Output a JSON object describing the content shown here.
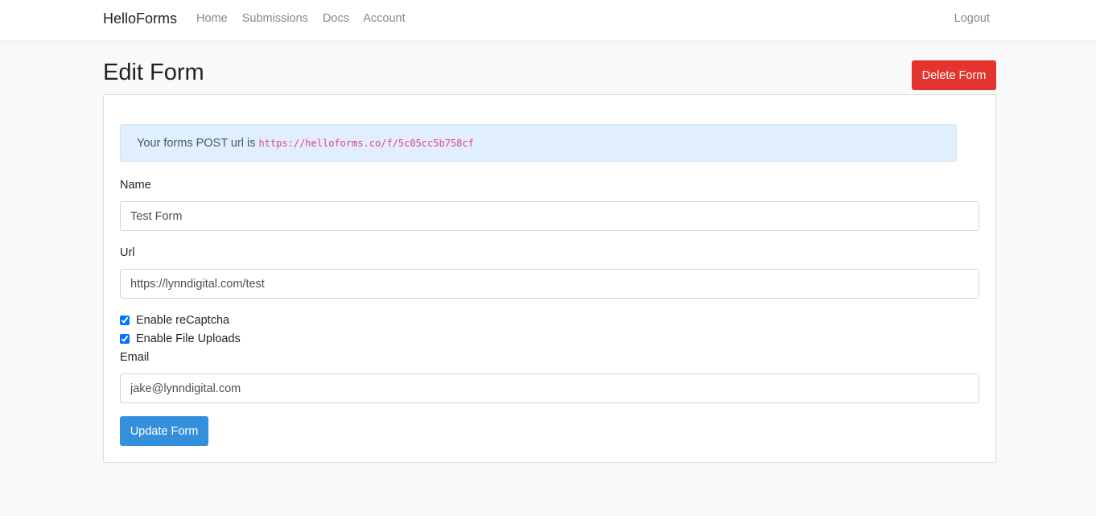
{
  "nav": {
    "brand": "HelloForms",
    "links": [
      "Home",
      "Submissions",
      "Docs",
      "Account"
    ],
    "logout": "Logout"
  },
  "page": {
    "title": "Edit Form",
    "delete_label": "Delete Form"
  },
  "alert": {
    "text": "Your forms POST url is ",
    "url": "https://helloforms.co/f/5c05cc5b758cf"
  },
  "form": {
    "name_label": "Name",
    "name_value": "Test Form",
    "url_label": "Url",
    "url_value": "https://lynndigital.com/test",
    "recaptcha_label": "Enable reCaptcha",
    "recaptcha_checked": true,
    "uploads_label": "Enable File Uploads",
    "uploads_checked": true,
    "email_label": "Email",
    "email_value": "jake@lynndigital.com",
    "submit_label": "Update Form"
  }
}
